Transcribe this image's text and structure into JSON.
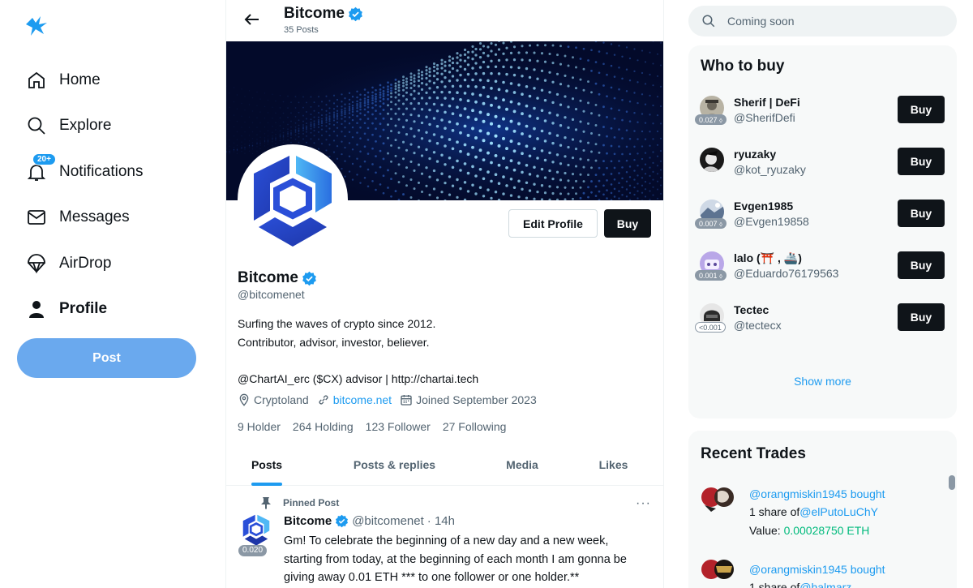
{
  "sidebar": {
    "logo_icon": "bird-logo-icon",
    "items": [
      {
        "label": "Home",
        "icon": "home-icon"
      },
      {
        "label": "Explore",
        "icon": "search-icon"
      },
      {
        "label": "Notifications",
        "icon": "bell-icon",
        "badge": "20+"
      },
      {
        "label": "Messages",
        "icon": "mail-icon"
      },
      {
        "label": "AirDrop",
        "icon": "parachute-icon"
      },
      {
        "label": "Profile",
        "icon": "person-icon",
        "active": true
      }
    ],
    "post_label": "Post"
  },
  "header": {
    "title": "Bitcome",
    "subtitle": "35 Posts"
  },
  "profile": {
    "name": "Bitcome",
    "handle": "@bitcomenet",
    "edit_label": "Edit Profile",
    "buy_label": "Buy",
    "bio": [
      "Surfing the waves of crypto since 2012.",
      "Contributor, advisor, investor, believer.",
      "",
      "@ChartAI_erc ($CX) advisor | http://chartai.tech"
    ],
    "location": "Cryptoland",
    "website": "bitcome.net",
    "joined": "Joined September 2023",
    "stats": {
      "holder": "9 Holder",
      "holding": "264 Holding",
      "follower": "123 Follower",
      "following": "27 Following"
    }
  },
  "tabs": [
    {
      "label": "Posts",
      "active": true
    },
    {
      "label": "Posts & replies"
    },
    {
      "label": "Media"
    },
    {
      "label": "Likes"
    }
  ],
  "pinned_post": {
    "pinned_label": "Pinned Post",
    "author": "Bitcome",
    "handle": "@bitcomenet",
    "time": "· 14h",
    "price": "0.020",
    "more": "···",
    "lines": [
      "Gm! To celebrate the beginning of a new day and a new week,",
      "starting from today, at the beginning of each month I am gonna be",
      "giving away 0.01 ETH *** to one follower or one holder.**"
    ]
  },
  "search": {
    "placeholder": "Coming soon"
  },
  "who_to_buy": {
    "title": "Who to buy",
    "buy_label": "Buy",
    "show_more": "Show more",
    "users": [
      {
        "name": "Sherif | DeFi",
        "handle": "@SherifDefi",
        "price": "0.027"
      },
      {
        "name": "ryuzaky",
        "handle": "@kot_ryuzaky",
        "price": ""
      },
      {
        "name": "Evgen1985",
        "handle": "@Evgen19858",
        "price": "0.007"
      },
      {
        "name": "lalo (⛩️ , 🚢)",
        "handle": "@Eduardo76179563",
        "price": "0.001"
      },
      {
        "name": "Tectec",
        "handle": "@tectecx",
        "price": "<0.001"
      }
    ]
  },
  "recent_trades": {
    "title": "Recent Trades",
    "trades": [
      {
        "user": "@orangmiskin1945",
        "verb": "bought",
        "share_text": "1 share of",
        "target": "@elPutoLuChY",
        "value_label": "Value:",
        "value": "0.00028750 ETH"
      },
      {
        "user": "@orangmiskin1945",
        "verb": "bought",
        "share_text": "1 share of",
        "target": "@halmarz"
      }
    ]
  },
  "colors": {
    "accent": "#1d9bf0",
    "post_button": "#6aa9ee",
    "dark_button": "#0f1419",
    "value_green": "#00ba7c"
  }
}
